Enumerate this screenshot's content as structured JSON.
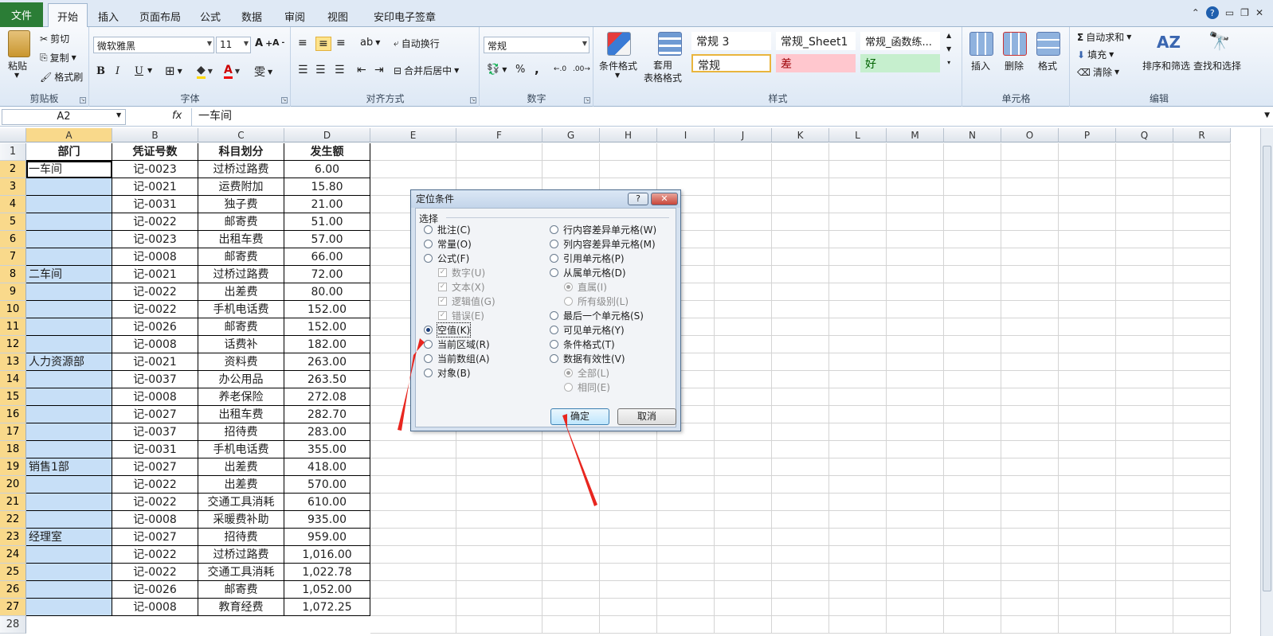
{
  "menu": {
    "file": "文件",
    "tabs": [
      "开始",
      "插入",
      "页面布局",
      "公式",
      "数据",
      "审阅",
      "视图",
      "安印电子签章"
    ],
    "active_tab": "开始"
  },
  "window_controls": {
    "help": "?"
  },
  "ribbon": {
    "clipboard": {
      "paste": "粘贴",
      "cut": "剪切",
      "copy": "复制",
      "format_painter": "格式刷",
      "label": "剪贴板"
    },
    "font": {
      "name": "微软雅黑",
      "size": "11",
      "bold": "B",
      "italic": "I",
      "underline": "U",
      "label": "字体"
    },
    "alignment": {
      "wrap": "自动换行",
      "merge": "合并后居中",
      "label": "对齐方式"
    },
    "number": {
      "format": "常规",
      "percent": "%",
      "comma": ",",
      "label": "数字"
    },
    "styles": {
      "conditional": "条件格式",
      "table_format": "套用\n表格格式",
      "box1": "常规 3",
      "box2": "常规_Sheet1",
      "box3": "常规_函数练...",
      "box4": "常规",
      "box5": "差",
      "box6": "好",
      "label": "样式"
    },
    "cells": {
      "insert": "插入",
      "delete": "删除",
      "format": "格式",
      "label": "单元格"
    },
    "editing": {
      "autosum": "自动求和",
      "fill": "填充",
      "clear": "清除",
      "sort": "排序和筛选",
      "find": "查找和选择",
      "label": "编辑"
    },
    "colors": {
      "green_tab": "#2b7d36",
      "selection": "#c7dff7",
      "bad_bg": "#ffc7ce",
      "good_bg": "#c6efce"
    }
  },
  "formula_bar": {
    "name_box": "A2",
    "fx": "fx",
    "content": "一车间"
  },
  "sheet": {
    "columns": [
      "A",
      "B",
      "C",
      "D",
      "E",
      "F",
      "G",
      "H",
      "I",
      "J",
      "K",
      "L",
      "M",
      "N",
      "O",
      "P",
      "Q",
      "R"
    ],
    "headers": [
      "部门",
      "凭证号数",
      "科目划分",
      "发生额"
    ],
    "rows": [
      [
        "一车间",
        "记-0023",
        "过桥过路费",
        "6.00"
      ],
      [
        "",
        "记-0021",
        "运费附加",
        "15.80"
      ],
      [
        "",
        "记-0031",
        "独子费",
        "21.00"
      ],
      [
        "",
        "记-0022",
        "邮寄费",
        "51.00"
      ],
      [
        "",
        "记-0023",
        "出租车费",
        "57.00"
      ],
      [
        "",
        "记-0008",
        "邮寄费",
        "66.00"
      ],
      [
        "二车间",
        "记-0021",
        "过桥过路费",
        "72.00"
      ],
      [
        "",
        "记-0022",
        "出差费",
        "80.00"
      ],
      [
        "",
        "记-0022",
        "手机电话费",
        "152.00"
      ],
      [
        "",
        "记-0026",
        "邮寄费",
        "152.00"
      ],
      [
        "",
        "记-0008",
        "话费补",
        "182.00"
      ],
      [
        "人力资源部",
        "记-0021",
        "资料费",
        "263.00"
      ],
      [
        "",
        "记-0037",
        "办公用品",
        "263.50"
      ],
      [
        "",
        "记-0008",
        "养老保险",
        "272.08"
      ],
      [
        "",
        "记-0027",
        "出租车费",
        "282.70"
      ],
      [
        "",
        "记-0037",
        "招待费",
        "283.00"
      ],
      [
        "",
        "记-0031",
        "手机电话费",
        "355.00"
      ],
      [
        "销售1部",
        "记-0027",
        "出差费",
        "418.00"
      ],
      [
        "",
        "记-0022",
        "出差费",
        "570.00"
      ],
      [
        "",
        "记-0022",
        "交通工具消耗",
        "610.00"
      ],
      [
        "",
        "记-0008",
        "采暖费补助",
        "935.00"
      ],
      [
        "经理室",
        "记-0027",
        "招待费",
        "959.00"
      ],
      [
        "",
        "记-0022",
        "过桥过路费",
        "1,016.00"
      ],
      [
        "",
        "记-0022",
        "交通工具消耗",
        "1,022.78"
      ],
      [
        "",
        "记-0026",
        "邮寄费",
        "1,052.00"
      ],
      [
        "",
        "记-0008",
        "教育经费",
        "1,072.25"
      ]
    ],
    "row_numbers": [
      "1",
      "2",
      "3",
      "4",
      "5",
      "6",
      "7",
      "8",
      "9",
      "10",
      "11",
      "12",
      "13",
      "14",
      "15",
      "16",
      "17",
      "18",
      "19",
      "20",
      "21",
      "22",
      "23",
      "24",
      "25",
      "26",
      "27",
      "28"
    ]
  },
  "dialog": {
    "title": "定位条件",
    "help_btn": "?",
    "close_btn": "✕",
    "section": "选择",
    "left_options": [
      {
        "label": "批注(C)",
        "checked": false,
        "disabled": false,
        "kind": "radio"
      },
      {
        "label": "常量(O)",
        "checked": false,
        "disabled": false,
        "kind": "radio"
      },
      {
        "label": "公式(F)",
        "checked": false,
        "disabled": false,
        "kind": "radio"
      },
      {
        "label": "数字(U)",
        "checked": true,
        "disabled": true,
        "kind": "check"
      },
      {
        "label": "文本(X)",
        "checked": true,
        "disabled": true,
        "kind": "check"
      },
      {
        "label": "逻辑值(G)",
        "checked": true,
        "disabled": true,
        "kind": "check"
      },
      {
        "label": "错误(E)",
        "checked": true,
        "disabled": true,
        "kind": "check"
      },
      {
        "label": "空值(K)",
        "checked": true,
        "disabled": false,
        "kind": "radio"
      },
      {
        "label": "当前区域(R)",
        "checked": false,
        "disabled": false,
        "kind": "radio"
      },
      {
        "label": "当前数组(A)",
        "checked": false,
        "disabled": false,
        "kind": "radio"
      },
      {
        "label": "对象(B)",
        "checked": false,
        "disabled": false,
        "kind": "radio"
      }
    ],
    "right_options": [
      {
        "label": "行内容差异单元格(W)",
        "checked": false,
        "disabled": false,
        "kind": "radio"
      },
      {
        "label": "列内容差异单元格(M)",
        "checked": false,
        "disabled": false,
        "kind": "radio"
      },
      {
        "label": "引用单元格(P)",
        "checked": false,
        "disabled": false,
        "kind": "radio"
      },
      {
        "label": "从属单元格(D)",
        "checked": false,
        "disabled": false,
        "kind": "radio"
      },
      {
        "label": "直属(I)",
        "checked": true,
        "disabled": true,
        "kind": "radio"
      },
      {
        "label": "所有级别(L)",
        "checked": false,
        "disabled": true,
        "kind": "radio"
      },
      {
        "label": "最后一个单元格(S)",
        "checked": false,
        "disabled": false,
        "kind": "radio"
      },
      {
        "label": "可见单元格(Y)",
        "checked": false,
        "disabled": false,
        "kind": "radio"
      },
      {
        "label": "条件格式(T)",
        "checked": false,
        "disabled": false,
        "kind": "radio"
      },
      {
        "label": "数据有效性(V)",
        "checked": false,
        "disabled": false,
        "kind": "radio"
      },
      {
        "label": "全部(L)",
        "checked": true,
        "disabled": true,
        "kind": "radio"
      },
      {
        "label": "相同(E)",
        "checked": false,
        "disabled": true,
        "kind": "radio"
      }
    ],
    "ok": "确定",
    "cancel": "取消"
  }
}
